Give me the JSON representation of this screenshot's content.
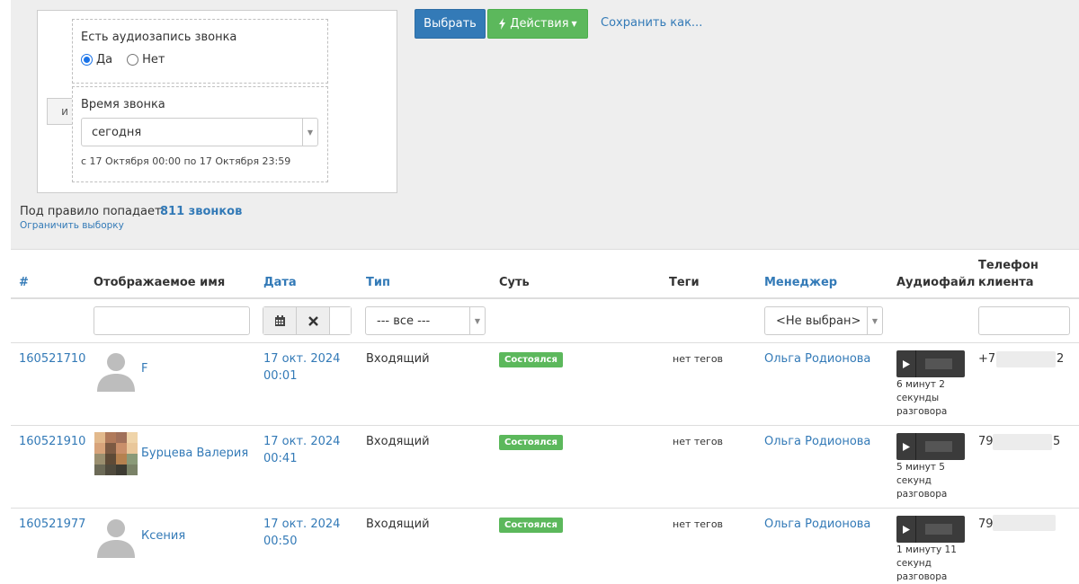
{
  "filter": {
    "and_label": "и",
    "conditions": [
      {
        "title": "Есть аудиозапись звонка",
        "options": [
          {
            "label": "Да",
            "checked": true
          },
          {
            "label": "Нет",
            "checked": false
          }
        ]
      },
      {
        "title": "Время звонка",
        "value": "сегодня",
        "range": "с 17 Октября 00:00 по 17 Октября 23:59"
      }
    ],
    "select_button": "Выбрать",
    "actions_button": "Действия",
    "save_as_link": "Сохранить как...",
    "rule_count_label": "Под правило попадает:",
    "rule_count": "811 звонков",
    "limit_link": "Ограничить выборку"
  },
  "table": {
    "headers": {
      "id": "#",
      "name": "Отображаемое имя",
      "date": "Дата",
      "type": "Тип",
      "essence": "Суть",
      "tags": "Теги",
      "manager": "Менеджер",
      "audio": "Аудиофайл",
      "phone_line1": "Телефон",
      "phone_line2": "клиента"
    },
    "filters": {
      "name_value": "",
      "type_value": "--- все ---",
      "manager_value": "<Не выбран>",
      "phone_value": ""
    },
    "rows": [
      {
        "id": "160521710",
        "name": "F",
        "avatar": "default-user",
        "date_line1": "17 окт. 2024",
        "date_line2": "00:01",
        "type": "Входящий",
        "status": "Состоялся",
        "tags": "нет тегов",
        "manager": "Ольга Родионова",
        "duration_line1": "6 минут 2",
        "duration_line2": "секунды",
        "duration_line3": "разговора",
        "phone_start": "+79",
        "phone_end": "2"
      },
      {
        "id": "160521910",
        "name": "Бурцева Валерия",
        "avatar": "photo",
        "date_line1": "17 окт. 2024",
        "date_line2": "00:41",
        "type": "Входящий",
        "status": "Состоялся",
        "tags": "нет тегов",
        "manager": "Ольга Родионова",
        "duration_line1": "5 минут 5",
        "duration_line2": "секунд",
        "duration_line3": "разговора",
        "phone_start": "79",
        "phone_end": "5"
      },
      {
        "id": "160521977",
        "name": "Ксения",
        "avatar": "default-user",
        "date_line1": "17 окт. 2024",
        "date_line2": "00:50",
        "type": "Входящий",
        "status": "Состоялся",
        "tags": "нет тегов",
        "manager": "Ольга Родионова",
        "duration_line1": "1 минуту 11",
        "duration_line2": "секунд",
        "duration_line3": "разговора",
        "phone_start": "79",
        "phone_end": ""
      }
    ]
  },
  "colors": {
    "link": "#337ab7",
    "primary_button": "#337ab7",
    "success_button": "#5cb85c",
    "status_badge": "#5cb85c",
    "panel_background": "#eeeeee"
  },
  "icons": {
    "actions": "lightning-icon",
    "calendar": "calendar-icon",
    "clear": "close-icon",
    "play": "play-icon"
  }
}
